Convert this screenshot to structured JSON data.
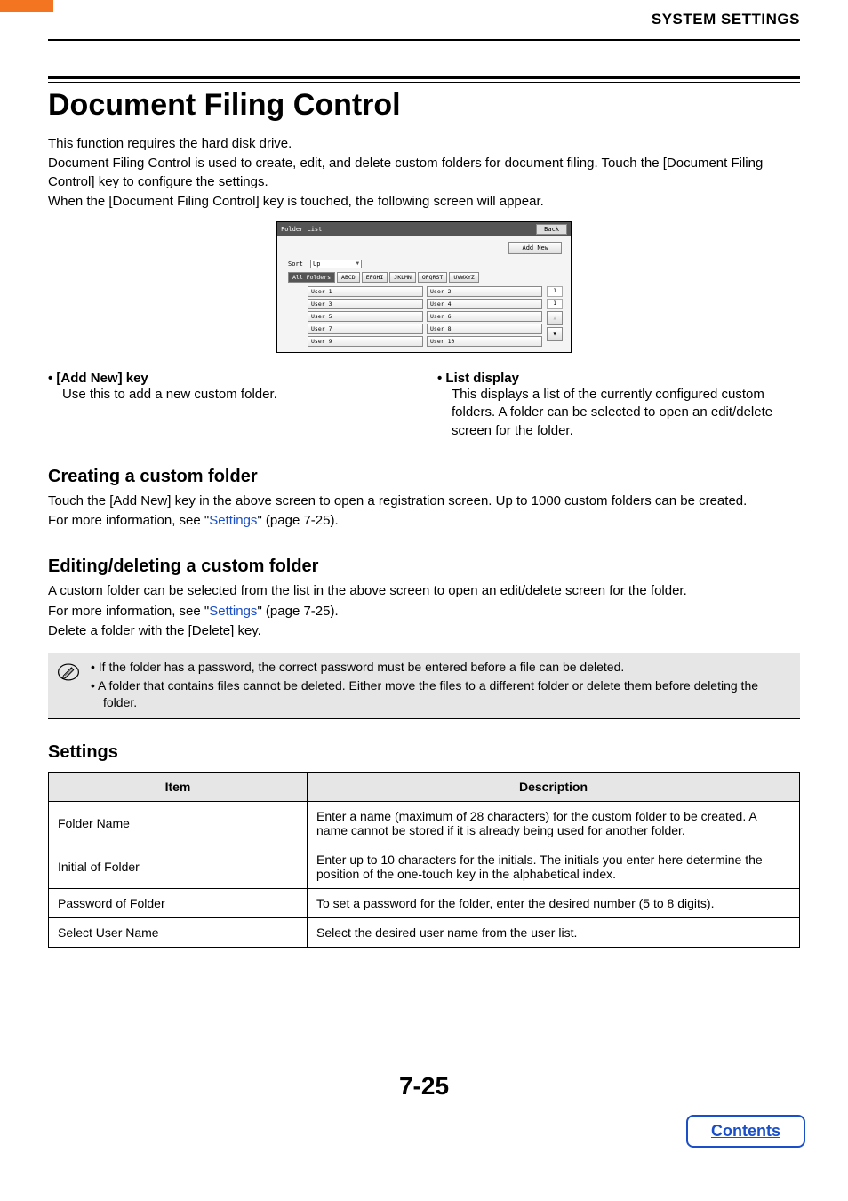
{
  "header": {
    "section": "SYSTEM SETTINGS"
  },
  "title": "Document Filing Control",
  "intro": {
    "p1": "This function requires the hard disk drive.",
    "p2": "Document Filing Control is used to create, edit, and delete custom folders for document filing. Touch the [Document Filing Control] key to configure the settings.",
    "p3": "When the [Document Filing Control] key is touched, the following screen will appear."
  },
  "screen": {
    "title": "Folder List",
    "back": "Back",
    "add_new": "Add New",
    "sort_label": "Sort",
    "sort_value": "Up",
    "tabs": [
      "All Folders",
      "ABCD",
      "EFGHI",
      "JKLMN",
      "OPQRST",
      "UVWXYZ"
    ],
    "col1": [
      "User 1",
      "User 3",
      "User 5",
      "User 7",
      "User 9"
    ],
    "col2": [
      "User 2",
      "User 4",
      "User 6",
      "User 8",
      "User 10"
    ],
    "page_cur": "1",
    "page_total": "1"
  },
  "features": {
    "addnew": {
      "title": "[Add New] key",
      "desc": "Use this to add a new custom folder."
    },
    "list": {
      "title": "List display",
      "desc": "This displays a list of the currently configured custom folders. A folder can be selected to open an edit/delete screen for the folder."
    }
  },
  "creating": {
    "heading": "Creating a custom folder",
    "p1_a": "Touch the [Add New] key in the above screen to open a registration screen. Up to 1000 custom folders can be created.",
    "p2_a": "For more information, see \"",
    "p2_link": "Settings",
    "p2_b": "\" (page 7-25)."
  },
  "editing": {
    "heading": "Editing/deleting a custom folder",
    "p1": "A custom folder can be selected from the list in the above screen to open an edit/delete screen for the folder.",
    "p2_a": "For more information, see \"",
    "p2_link": "Settings",
    "p2_b": "\" (page 7-25).",
    "p3": "Delete a folder with the [Delete] key."
  },
  "notes": {
    "n1": "If the folder has a password, the correct password must be entered before a file can be deleted.",
    "n2": "A folder that contains files cannot be deleted. Either move the files to a different folder or delete them before deleting the folder."
  },
  "settings": {
    "heading": "Settings",
    "th_item": "Item",
    "th_desc": "Description",
    "rows": [
      {
        "item": "Folder Name",
        "desc": "Enter a name (maximum of 28 characters) for the custom folder to be created. A name cannot be stored if it is already being used for another folder."
      },
      {
        "item": "Initial of Folder",
        "desc": "Enter up to 10 characters for the initials. The initials you enter here determine the position of the one-touch key in the alphabetical index."
      },
      {
        "item": "Password of Folder",
        "desc": "To set a password for the folder, enter the desired number (5 to 8 digits)."
      },
      {
        "item": "Select User Name",
        "desc": "Select the desired user name from the user list."
      }
    ]
  },
  "page_num": "7-25",
  "contents_button": "Contents"
}
